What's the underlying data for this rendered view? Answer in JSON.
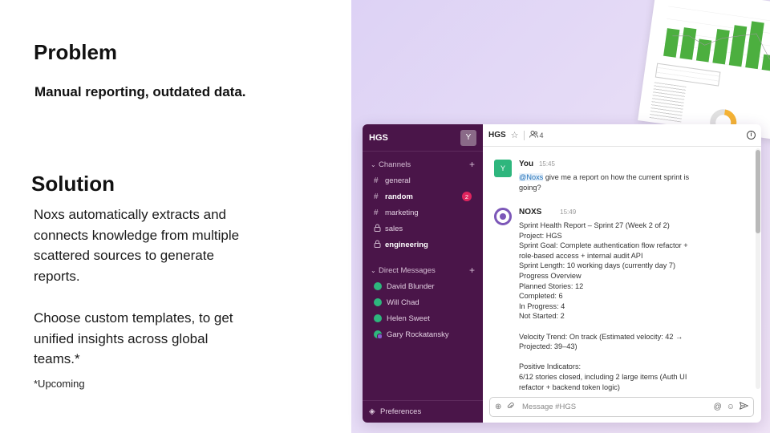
{
  "slide": {
    "problem_heading": "Problem",
    "problem_text": "Manual reporting, outdated data.",
    "solution_heading": "Solution",
    "solution_p1_lines": [
      "Noxs automatically extracts and",
      "connects knowledge from multiple",
      "scattered sources to generate",
      "reports."
    ],
    "solution_p2_lines": [
      "Choose custom templates, to get",
      "unified insights across global",
      "teams.*"
    ],
    "footnote": "*Upcoming"
  },
  "sidebar": {
    "workspace": "HGS",
    "avatar_letter": "Y",
    "channels_label": "Channels",
    "channels": [
      {
        "label": "general",
        "icon": "hash-icon",
        "bold": false,
        "badge": ""
      },
      {
        "label": "random",
        "icon": "hash-icon",
        "bold": true,
        "badge": "2"
      },
      {
        "label": "marketing",
        "icon": "hash-icon",
        "bold": false,
        "badge": ""
      },
      {
        "label": "sales",
        "icon": "lock-icon",
        "bold": false,
        "badge": ""
      },
      {
        "label": "engineering",
        "icon": "lock-icon",
        "bold": true,
        "badge": ""
      }
    ],
    "dm_label": "Direct Messages",
    "dms": [
      {
        "label": "David Blunder"
      },
      {
        "label": "Will Chad"
      },
      {
        "label": "Helen Sweet"
      },
      {
        "label": "Gary Rockatansky"
      }
    ],
    "preferences": "Preferences"
  },
  "channel": {
    "name": "HGS",
    "member_count": "4"
  },
  "messages": {
    "you": {
      "avatar": "Y",
      "name": "You",
      "time": "15:45",
      "mention": "@Noxs",
      "line1_rest": " give me a report on how the current sprint is",
      "line2": "going?"
    },
    "noxs": {
      "name": "NOXS",
      "time": "15:49",
      "lines": [
        "Sprint Health Report – Sprint 27 (Week 2 of 2)",
        "Project: HGS",
        "Sprint Goal: Complete authentication flow refactor +",
        "role-based access + internal audit API",
        "Sprint Length: 10 working days (currently day 7)",
        "Progress Overview",
        "Planned Stories: 12",
        "Completed: 6",
        "In Progress: 4",
        "Not Started: 2",
        "",
        "Velocity Trend: On track (Estimated velocity: 42 →",
        "Projected: 39–43)",
        "",
        "Positive Indicators:",
        "6/12 stories closed, including 2 large items (Auth UI",
        "refactor + backend token logic)"
      ]
    }
  },
  "composer": {
    "placeholder": "Message #HGS"
  },
  "report_thumbnail": {
    "bar_values": [
      18,
      20,
      14,
      22,
      26,
      30,
      10,
      6
    ]
  },
  "colors": {
    "sidebar_bg": "#4a1549",
    "badge": "#e0245e",
    "presence": "#2eb67d",
    "bot_accent": "#7c57b8",
    "chart_green": "#4caf3f"
  }
}
